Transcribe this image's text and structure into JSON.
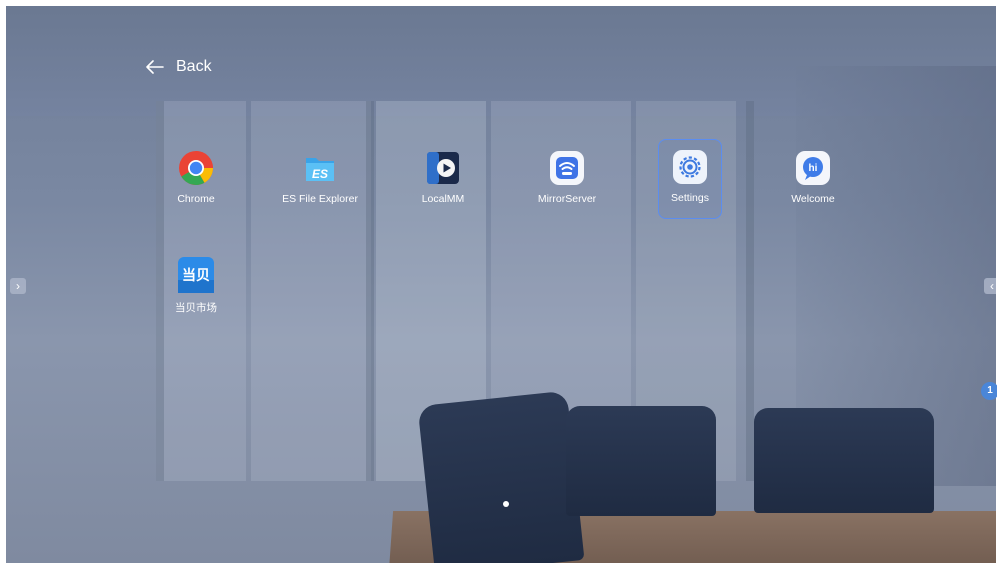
{
  "nav": {
    "back_label": "Back",
    "back_icon": "arrow-left-icon"
  },
  "apps": [
    {
      "name": "Chrome",
      "icon": "chrome-icon"
    },
    {
      "name": "ES File Explorer",
      "icon": "es-file-explorer-icon"
    },
    {
      "name": "LocalMM",
      "icon": "localmm-icon"
    },
    {
      "name": "MirrorServer",
      "icon": "mirror-server-icon"
    },
    {
      "name": "Settings",
      "icon": "settings-gear-icon",
      "selected": true
    },
    {
      "name": "Welcome",
      "icon": "welcome-hi-icon"
    },
    {
      "name": "当贝市场",
      "icon": "dangbei-market-icon",
      "logo_text": "当贝"
    }
  ],
  "edges": {
    "left_arrow": "›",
    "right_arrow": "‹"
  },
  "pagination": {
    "badge": "1"
  },
  "colors": {
    "selection": "#5b8df0",
    "chrome_red": "#ea4335",
    "chrome_yellow": "#fbbc05",
    "chrome_green": "#34a853",
    "chrome_blue": "#4285f4"
  }
}
